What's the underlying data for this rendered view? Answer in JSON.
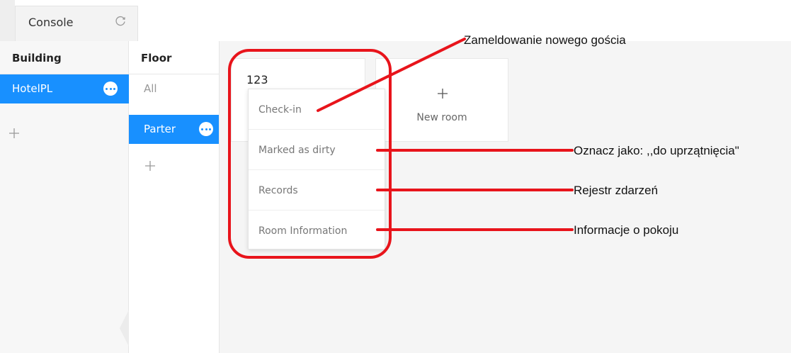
{
  "tab": {
    "label": "Console",
    "refresh_icon": "refresh-icon"
  },
  "building": {
    "header": "Building",
    "items": [
      {
        "label": "HotelPL",
        "selected": true
      }
    ],
    "add_icon": "plus-icon"
  },
  "floor": {
    "header": "Floor",
    "items": [
      {
        "label": "All",
        "selected": false
      },
      {
        "label": "Parter",
        "selected": true
      }
    ],
    "add_icon": "plus-icon"
  },
  "rooms": {
    "cards": [
      {
        "number": "123"
      }
    ],
    "new_room_label": "New room"
  },
  "context_menu": {
    "items": [
      {
        "label": "Check-in"
      },
      {
        "label": "Marked as dirty"
      },
      {
        "label": "Records"
      },
      {
        "label": "Room Information"
      }
    ]
  },
  "annotations": {
    "checkin": "Zameldowanie nowego gościa",
    "dirty": "Oznacz jako: ,,do uprzątnięcia\"",
    "records": "Rejestr zdarzeń",
    "room_info": "Informacje o pokoju"
  },
  "colors": {
    "accent": "#1890ff",
    "highlight": "#e8141b"
  }
}
